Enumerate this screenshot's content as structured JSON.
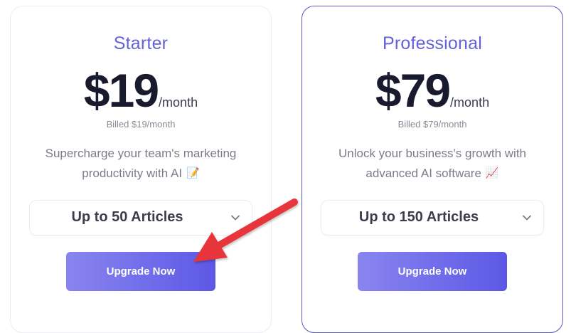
{
  "plans": [
    {
      "name": "Starter",
      "price": "$19",
      "period": "/month",
      "billed": "Billed $19/month",
      "description_line1": "Supercharge your team's marketing",
      "description_line2": "productivity with AI",
      "emoji": "📝",
      "articles": "Up to 50 Articles",
      "button": "Upgrade Now"
    },
    {
      "name": "Professional",
      "price": "$79",
      "period": "/month",
      "billed": "Billed $79/month",
      "description_line1": "Unlock your business's growth with",
      "description_line2": "advanced AI software",
      "emoji": "📈",
      "articles": "Up to 150 Articles",
      "button": "Upgrade Now"
    }
  ],
  "colors": {
    "accent": "#6661d6",
    "button_gradient_start": "#8985ef",
    "button_gradient_end": "#5c58e6",
    "highlight_border": "#5a55c6",
    "annotation_arrow": "#e8353a"
  }
}
